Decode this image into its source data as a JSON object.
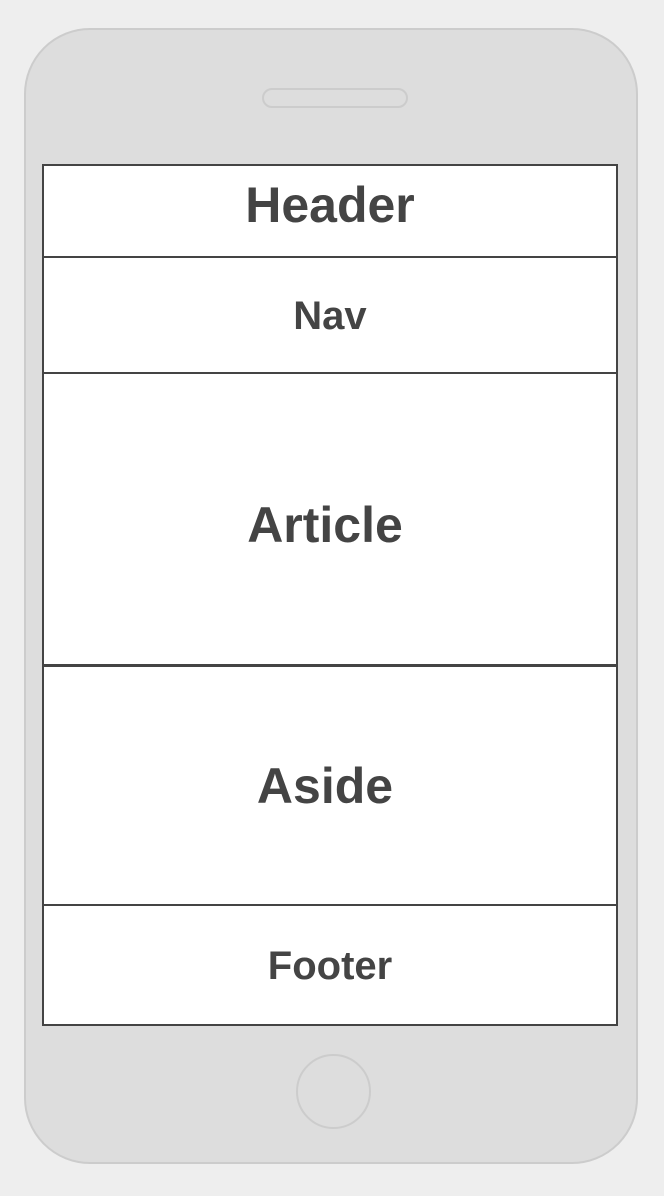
{
  "device": {
    "type": "phone",
    "colors": {
      "background": "#eeeeee",
      "body": "#dddddd",
      "outline": "#cccccc",
      "screen": "#ffffff",
      "border": "#444444",
      "text": "#444444"
    }
  },
  "layout": {
    "header": "Header",
    "nav": "Nav",
    "article": "Article",
    "aside": "Aside",
    "footer": "Footer"
  }
}
